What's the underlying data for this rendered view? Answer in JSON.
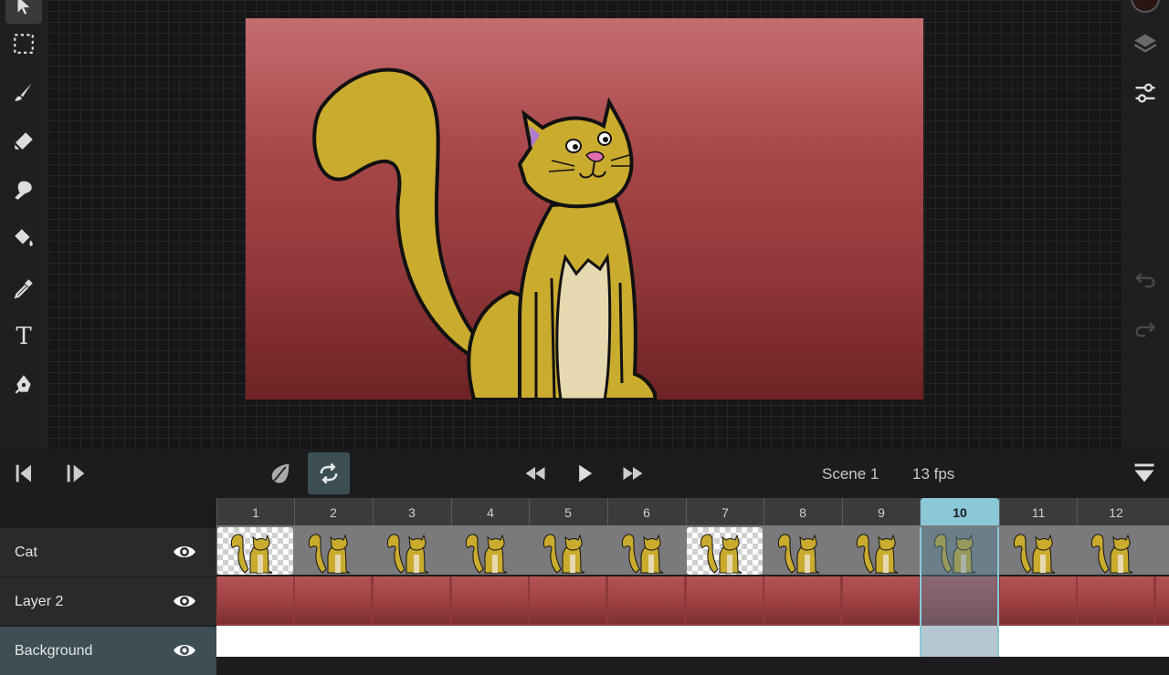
{
  "tools": [
    {
      "name": "select-arrow-icon",
      "active": true
    },
    {
      "name": "marquee-select-icon"
    },
    {
      "name": "brush-icon"
    },
    {
      "name": "eraser-icon"
    },
    {
      "name": "smudge-icon"
    },
    {
      "name": "fill-bucket-icon"
    },
    {
      "name": "eyedropper-icon"
    },
    {
      "name": "text-tool-icon",
      "glyph": "T"
    },
    {
      "name": "pen-tool-icon"
    }
  ],
  "right_tools": [
    "color-swatch",
    "layers-icon",
    "adjustments-icon",
    "undo-icon",
    "redo-icon"
  ],
  "playback": {
    "scene_label": "Scene 1",
    "fps_label": "13 fps"
  },
  "timeline": {
    "frames": [
      "1",
      "2",
      "3",
      "4",
      "5",
      "6",
      "7",
      "8",
      "9",
      "10",
      "11",
      "12"
    ],
    "current_frame": "10",
    "layers": [
      {
        "name": "Cat",
        "visible": true,
        "selected": false
      },
      {
        "name": "Layer 2",
        "visible": true,
        "selected": false
      },
      {
        "name": "Background",
        "visible": true,
        "selected": true
      }
    ]
  },
  "colors": {
    "accent": "#8ac8d8",
    "cat_fill": "#c9ab2e",
    "belly": "#e6d9b0",
    "nose": "#e06fb0"
  }
}
